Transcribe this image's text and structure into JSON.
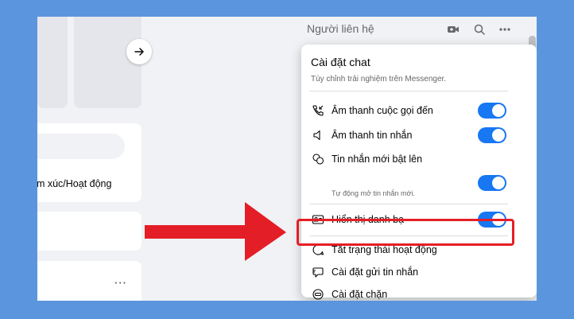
{
  "left": {
    "composer_label": "ảm xúc/Hoạt động",
    "post_more": "···"
  },
  "contacts": {
    "title": "Người liên hệ",
    "icons": [
      "video-call-icon",
      "search-icon",
      "more-icon"
    ]
  },
  "menu": {
    "title": "Cài đặt chat",
    "subtitle": "Tùy chỉnh trải nghiệm trên Messenger.",
    "items": [
      {
        "label": "Âm thanh cuộc gọi đến",
        "icon": "phone-incoming-icon",
        "toggle": true
      },
      {
        "label": "Âm thanh tin nhắn",
        "icon": "speaker-icon",
        "toggle": true
      },
      {
        "label": "Tin nhắn mới bật lên",
        "icon": "chat-bubbles-icon",
        "toggle": true,
        "note": "Tự động mở tin nhắn mới."
      },
      {
        "label": "Hiển thị danh bạ",
        "icon": "contact-card-icon",
        "toggle": true
      },
      {
        "label": "Tắt trạng thái hoạt động",
        "icon": "status-bubble-icon"
      },
      {
        "label": "Cài đặt gửi tin nhắn",
        "icon": "message-settings-icon"
      },
      {
        "label": "Cài đặt chặn",
        "icon": "block-icon"
      }
    ]
  },
  "colors": {
    "background": "#5b95de",
    "toggle_on": "#1877f2",
    "highlight": "#e41e26",
    "arrow": "#e41e26"
  }
}
